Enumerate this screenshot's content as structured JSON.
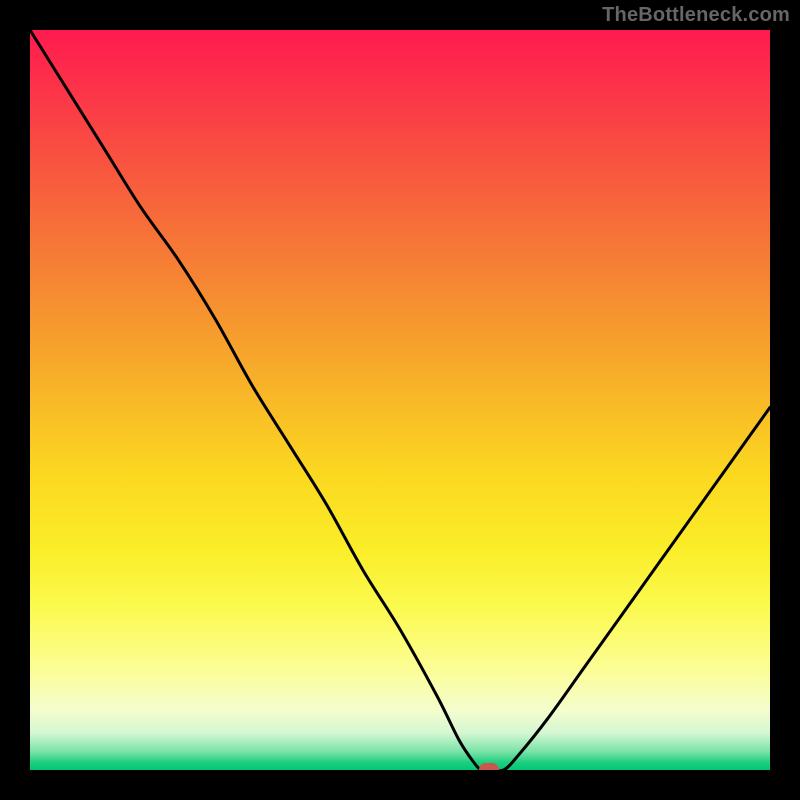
{
  "attribution": "TheBottleneck.com",
  "colors": {
    "frame": "#000000",
    "marker": "#c8584e",
    "curve": "#000000",
    "attribution_text": "#666666"
  },
  "chart_data": {
    "type": "line",
    "title": "",
    "xlabel": "",
    "ylabel": "",
    "xlim": [
      0,
      100
    ],
    "ylim": [
      0,
      100
    ],
    "x": [
      0,
      5,
      10,
      15,
      20,
      25,
      30,
      35,
      40,
      45,
      50,
      55,
      58,
      60,
      61,
      62,
      64,
      66,
      70,
      75,
      80,
      85,
      90,
      95,
      100
    ],
    "values": [
      100,
      92,
      84,
      76,
      69,
      61,
      52,
      44,
      36,
      27,
      19,
      10,
      4,
      1,
      0,
      0,
      0,
      2,
      7,
      14,
      21,
      28,
      35,
      42,
      49
    ],
    "series": [
      {
        "name": "bottleneck-curve",
        "values": [
          100,
          92,
          84,
          76,
          69,
          61,
          52,
          44,
          36,
          27,
          19,
          10,
          4,
          1,
          0,
          0,
          0,
          2,
          7,
          14,
          21,
          28,
          35,
          42,
          49
        ]
      }
    ],
    "marker": {
      "x": 62,
      "y": 0
    },
    "gradient_stops": [
      {
        "pct": 0,
        "color": "#ff1a4f"
      },
      {
        "pct": 50,
        "color": "#f8b927"
      },
      {
        "pct": 80,
        "color": "#fbfa4f"
      },
      {
        "pct": 97,
        "color": "#7be3a7"
      },
      {
        "pct": 100,
        "color": "#00c878"
      }
    ],
    "legend": null,
    "grid": false
  }
}
